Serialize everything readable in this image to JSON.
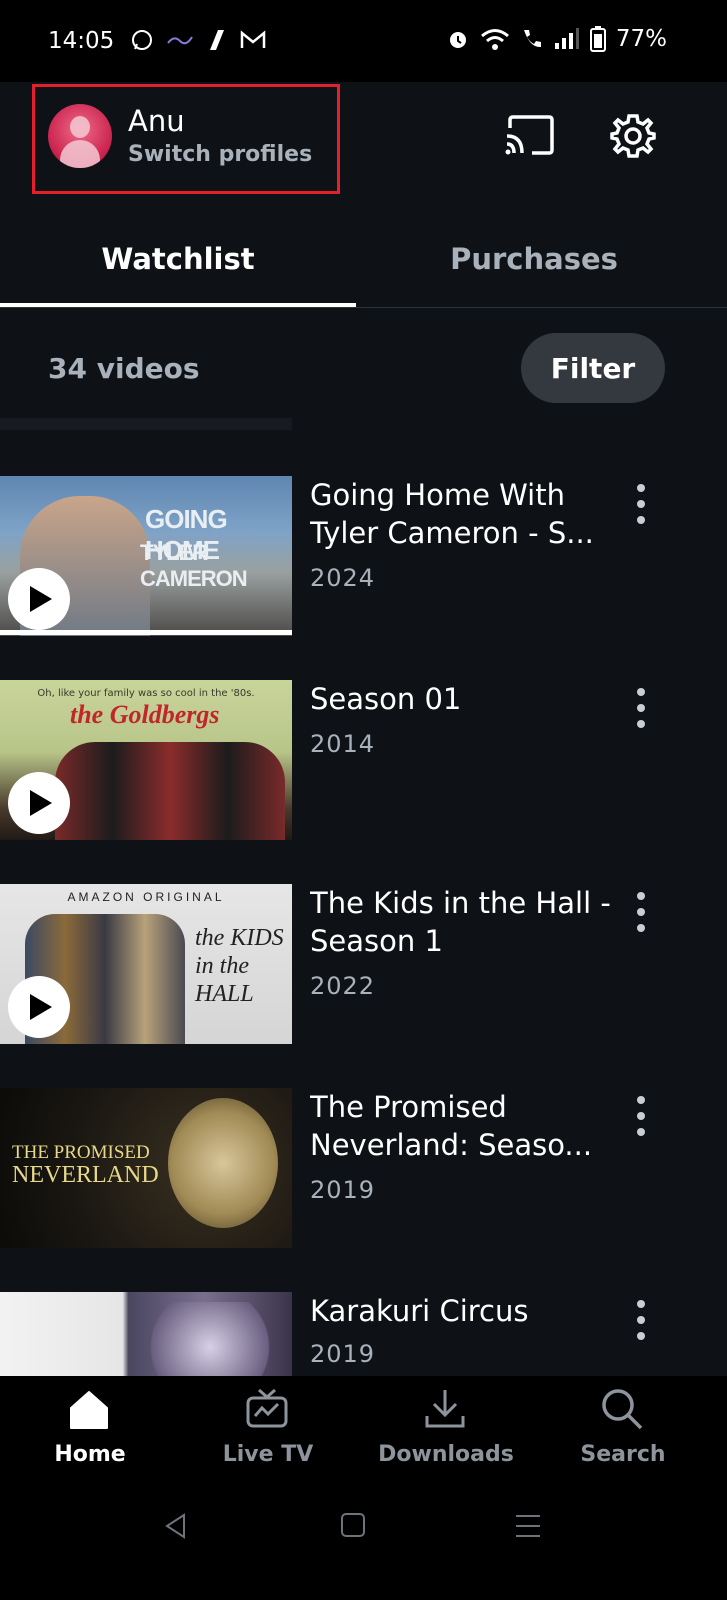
{
  "status_bar": {
    "time": "14:05",
    "battery": "77%"
  },
  "profile": {
    "name": "Anu",
    "subtitle": "Switch profiles"
  },
  "header_icons": [
    "cast-icon",
    "gear-icon"
  ],
  "tabs": [
    {
      "label": "Watchlist",
      "active": true
    },
    {
      "label": "Purchases",
      "active": false
    }
  ],
  "list_header": {
    "count": "34 videos",
    "filter_label": "Filter"
  },
  "items": [
    {
      "title": "Going Home With Tyler Cameron - S...",
      "year": "2024",
      "thumb_text": [
        "GOING HOME",
        "TYLER CAMERON"
      ],
      "playable": true,
      "progress": 1.0
    },
    {
      "title": "Season 01",
      "year": "2014",
      "thumb_text": [
        "Oh, like your family was so cool in the '80s.",
        "the Goldbergs"
      ],
      "playable": true
    },
    {
      "title": "The Kids in the Hall - Season 1",
      "year": "2022",
      "thumb_text": [
        "AMAZON ORIGINAL",
        "the KIDS in the HALL"
      ],
      "playable": true
    },
    {
      "title": "The Promised Neverland: Seaso...",
      "year": "2019",
      "thumb_text": [
        "THE PROMISED",
        "NEVERLAND"
      ],
      "playable": false
    },
    {
      "title": "Karakuri Circus",
      "year": "2019",
      "playable": false
    }
  ],
  "nav": [
    {
      "label": "Home",
      "icon": "home-icon",
      "active": true
    },
    {
      "label": "Live TV",
      "icon": "tv-icon",
      "active": false
    },
    {
      "label": "Downloads",
      "icon": "download-icon",
      "active": false
    },
    {
      "label": "Search",
      "icon": "search-icon",
      "active": false
    }
  ],
  "colors": {
    "background": "#0e1217",
    "highlight_box": "#e4202d",
    "muted_text": "#a9b1bb"
  }
}
